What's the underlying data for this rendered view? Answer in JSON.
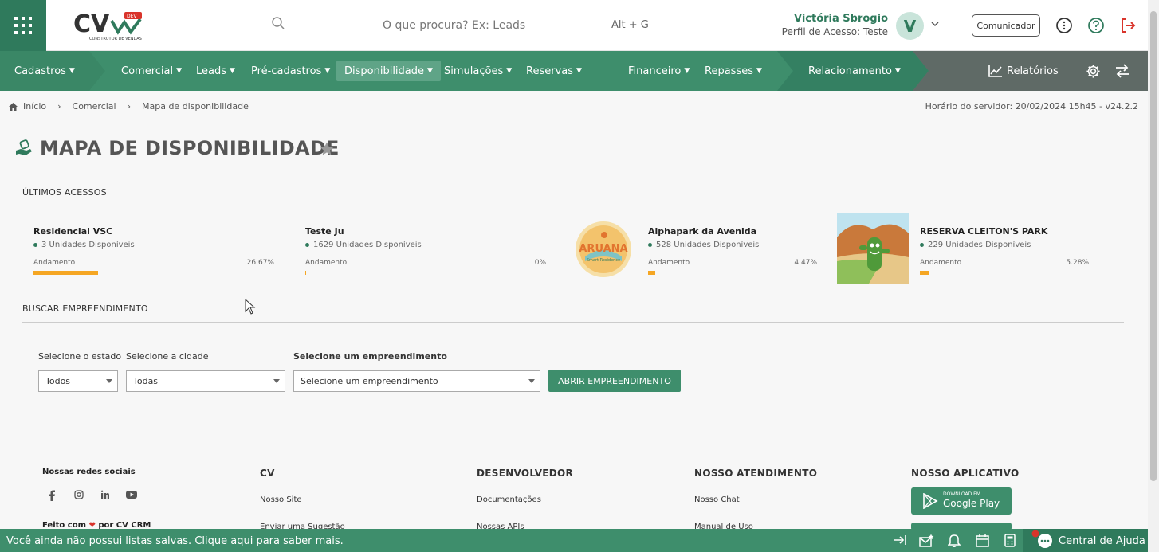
{
  "header": {
    "logo_text": "CV",
    "logo_badge": "DEV",
    "logo_subtitle": "CONSTRUTOR DE VENDAS",
    "search_placeholder": "O que procura? Ex: Leads",
    "search_shortcut": "Alt + G",
    "user_name": "Victória Sbrogio",
    "user_profile": "Perfil de Acesso: Teste",
    "avatar_letter": "V",
    "communicator_label": "Comunicador"
  },
  "nav": {
    "items": [
      {
        "label": "Cadastros",
        "dropdown": true
      },
      {
        "label": "Comercial",
        "dropdown": true
      },
      {
        "label": "Leads",
        "dropdown": true
      },
      {
        "label": "Pré-cadastros",
        "dropdown": true
      },
      {
        "label": "Disponibilidade",
        "dropdown": true,
        "active": true
      },
      {
        "label": "Simulações",
        "dropdown": true
      },
      {
        "label": "Reservas",
        "dropdown": true
      },
      {
        "label": "Financeiro",
        "dropdown": true
      },
      {
        "label": "Repasses",
        "dropdown": true
      },
      {
        "label": "Relacionamento",
        "dropdown": true
      },
      {
        "label": "Relatórios",
        "dropdown": false
      }
    ]
  },
  "breadcrumb": [
    "Início",
    "Comercial",
    "Mapa de disponibilidade"
  ],
  "server_time": "Horário do servidor: 20/02/2024 15h45 - v24.2.2",
  "page_title": "MAPA DE DISPONIBILIDADE",
  "recent": {
    "label": "ÚLTIMOS ACESSOS",
    "progress_label": "Andamento",
    "cards": [
      {
        "name": "Residencial VSC",
        "units": "3 Unidades Disponíveis",
        "percent_text": "26.67%",
        "progress": 0.2667,
        "has_image": false
      },
      {
        "name": "Teste Ju",
        "units": "1629 Unidades Disponíveis",
        "percent_text": "0%",
        "progress": 0.0,
        "has_image": false
      },
      {
        "name": "Alphapark da Avenida",
        "units": "528 Unidades Disponíveis",
        "percent_text": "4.47%",
        "progress": 0.0447,
        "has_image": true,
        "image_text": "ARUANA",
        "image_subtext": "Smart Residence"
      },
      {
        "name": "RESERVA CLEITON'S PARK",
        "units": "229 Unidades Disponíveis",
        "percent_text": "5.28%",
        "progress": 0.0528,
        "has_image": true
      }
    ]
  },
  "search": {
    "label": "BUSCAR EMPREENDIMENTO",
    "state_label": "Selecione o estado",
    "state_value": "Todos",
    "city_label": "Selecione a cidade",
    "city_value": "Todas",
    "project_label": "Selecione um empreendimento",
    "project_value": "Selecione um empreendimento",
    "open_button": "ABRIR EMPREENDIMENTO"
  },
  "footer": {
    "social_head": "Nossas redes sociais",
    "made_with": "Feito com",
    "made_by": "por CV CRM",
    "cv_head": "CV",
    "cv_links": [
      "Nosso Site",
      "Enviar uma Sugestão"
    ],
    "dev_head": "DESENVOLVEDOR",
    "dev_links": [
      "Documentações",
      "Nossas APIs"
    ],
    "support_head": "NOSSO ATENDIMENTO",
    "support_links": [
      "Nosso Chat",
      "Manual de Uso"
    ],
    "app_head": "NOSSO APLICATIVO",
    "google_small": "DOWNLOAD EM",
    "google_big": "Google Play"
  },
  "bottombar": {
    "message": "Você ainda não possui listas salvas. Clique aqui para saber mais.",
    "help_label": "Central de Ajuda"
  },
  "colors": {
    "brand_green": "#2f7a5c",
    "nav_green": "#3e8e6c",
    "progress_orange": "#f5a623",
    "logout_red": "#d9342b"
  }
}
